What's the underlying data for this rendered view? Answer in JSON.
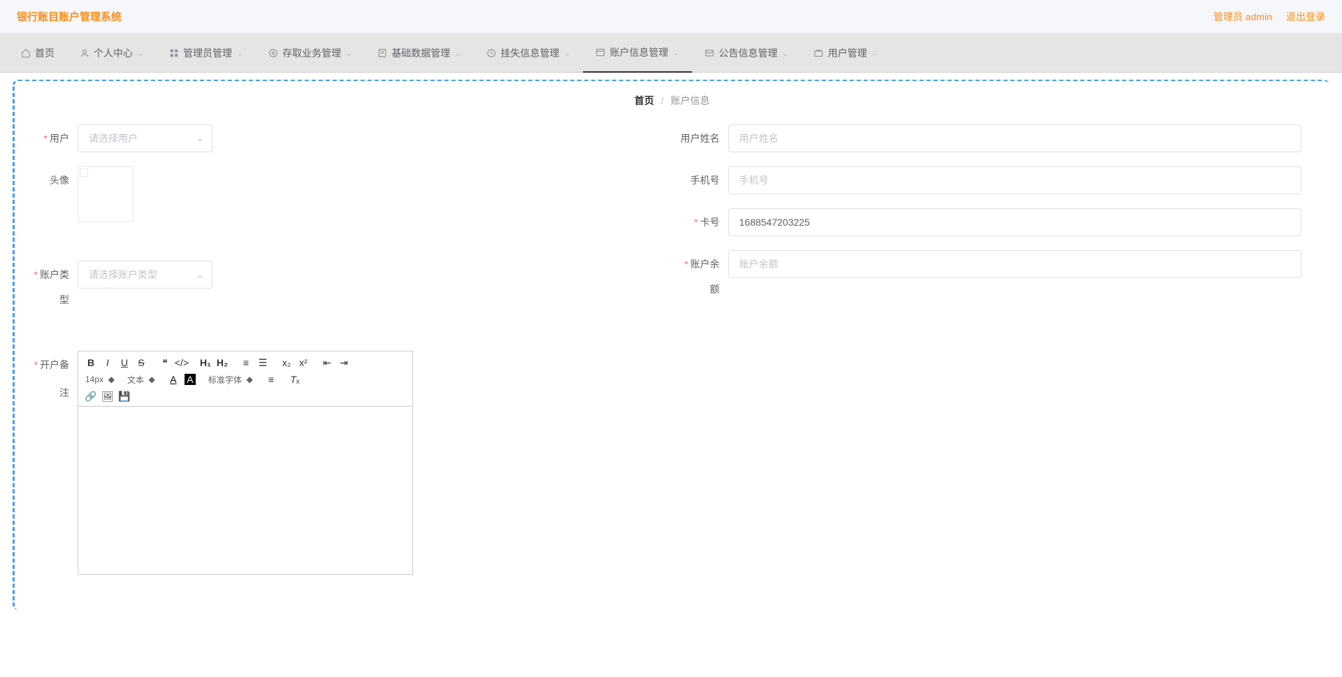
{
  "header": {
    "app_title": "银行账目账户管理系统",
    "admin_text": "管理员 admin",
    "logout_text": "退出登录"
  },
  "nav": {
    "items": [
      {
        "label": "首页",
        "icon": "home",
        "has_chevron": false
      },
      {
        "label": "个人中心",
        "icon": "user",
        "has_chevron": true
      },
      {
        "label": "管理员管理",
        "icon": "grid",
        "has_chevron": true
      },
      {
        "label": "存取业务管理",
        "icon": "circle",
        "has_chevron": true
      },
      {
        "label": "基础数据管理",
        "icon": "doc",
        "has_chevron": true
      },
      {
        "label": "挂失信息管理",
        "icon": "clock",
        "has_chevron": true
      },
      {
        "label": "账户信息管理",
        "icon": "list",
        "has_chevron": true,
        "active": true
      },
      {
        "label": "公告信息管理",
        "icon": "mail",
        "has_chevron": true
      },
      {
        "label": "用户管理",
        "icon": "folder",
        "has_chevron": true
      }
    ]
  },
  "breadcrumb": {
    "home": "首页",
    "separator": "/",
    "current": "账户信息"
  },
  "form": {
    "user": {
      "label": "用户",
      "placeholder": "请选择用户",
      "required": true
    },
    "username": {
      "label": "用户姓名",
      "placeholder": "用户姓名",
      "required": false
    },
    "avatar": {
      "label": "头像"
    },
    "phone": {
      "label": "手机号",
      "placeholder": "手机号",
      "required": false
    },
    "card": {
      "label": "卡号",
      "value": "1688547203225",
      "required": true
    },
    "account_type": {
      "label_line1": "账户类",
      "label_line2": "型",
      "placeholder": "请选择账户类型",
      "required": true
    },
    "balance": {
      "label_line1": "账户余",
      "label_line2": "额",
      "placeholder": "账户余额",
      "required": true
    },
    "remark": {
      "label": "开户备注",
      "required": true
    }
  },
  "editor": {
    "font_size_label": "14px",
    "format_label": "文本",
    "font_family_label": "标准字体"
  }
}
